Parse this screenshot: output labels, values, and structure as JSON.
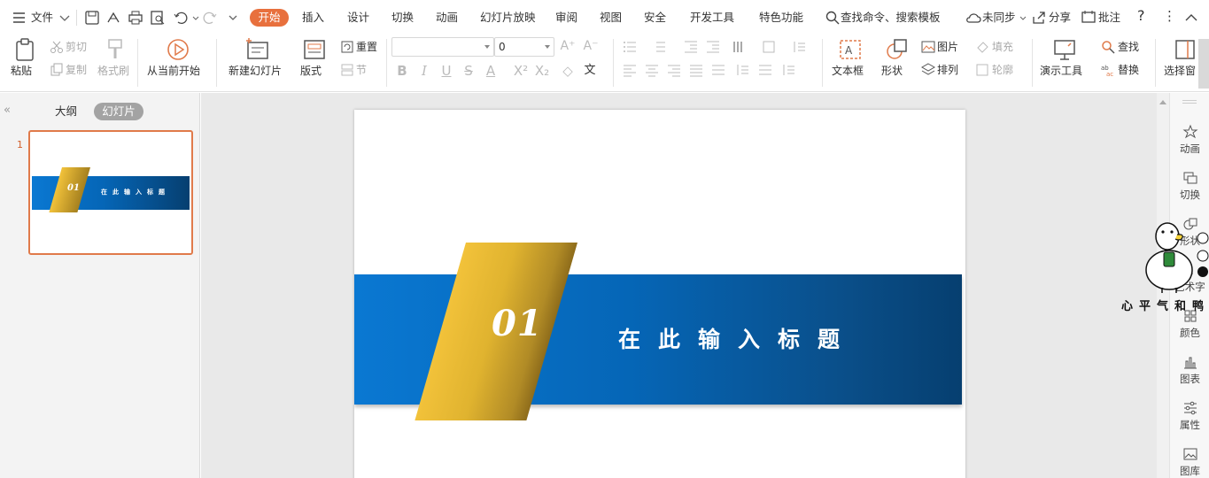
{
  "menubar": {
    "file_label": "文件",
    "tabs": [
      "开始",
      "插入",
      "设计",
      "切换",
      "动画",
      "幻灯片放映",
      "审阅",
      "视图",
      "安全",
      "开发工具",
      "特色功能"
    ],
    "active_tab": "开始",
    "search_label": "查找命令、搜索模板",
    "sync_label": "未同步",
    "share_label": "分享",
    "comment_label": "批注",
    "help_label": "?",
    "more_label": "⋮",
    "accent_color": "#e8703d"
  },
  "ribbon": {
    "paste": "粘贴",
    "cut": "剪切",
    "copy": "复制",
    "format_painter": "格式刷",
    "from_current": "从当前开始",
    "new_slide": "新建幻灯片",
    "layout": "版式",
    "reset": "重置",
    "section": "节",
    "font_name": "",
    "font_size": "0",
    "text_box": "文本框",
    "shape": "形状",
    "picture": "图片",
    "fill": "填充",
    "arrange": "排列",
    "outline": "轮廓",
    "presentation_tools": "演示工具",
    "find": "查找",
    "replace": "替换",
    "select_pane": "选择窗"
  },
  "leftpane": {
    "outline_tab": "大纲",
    "slides_tab": "幻灯片",
    "slide_number": "1"
  },
  "slide": {
    "number": "01",
    "title": "在此输入标题",
    "band_color": "#0566b7",
    "accent_color": "#f2c23a"
  },
  "rightpane": {
    "items": [
      "动画",
      "切换",
      "形状",
      "艺术字",
      "颜色",
      "图表",
      "属性",
      "图库"
    ]
  },
  "watermark": {
    "text": "心平气和鸭"
  }
}
